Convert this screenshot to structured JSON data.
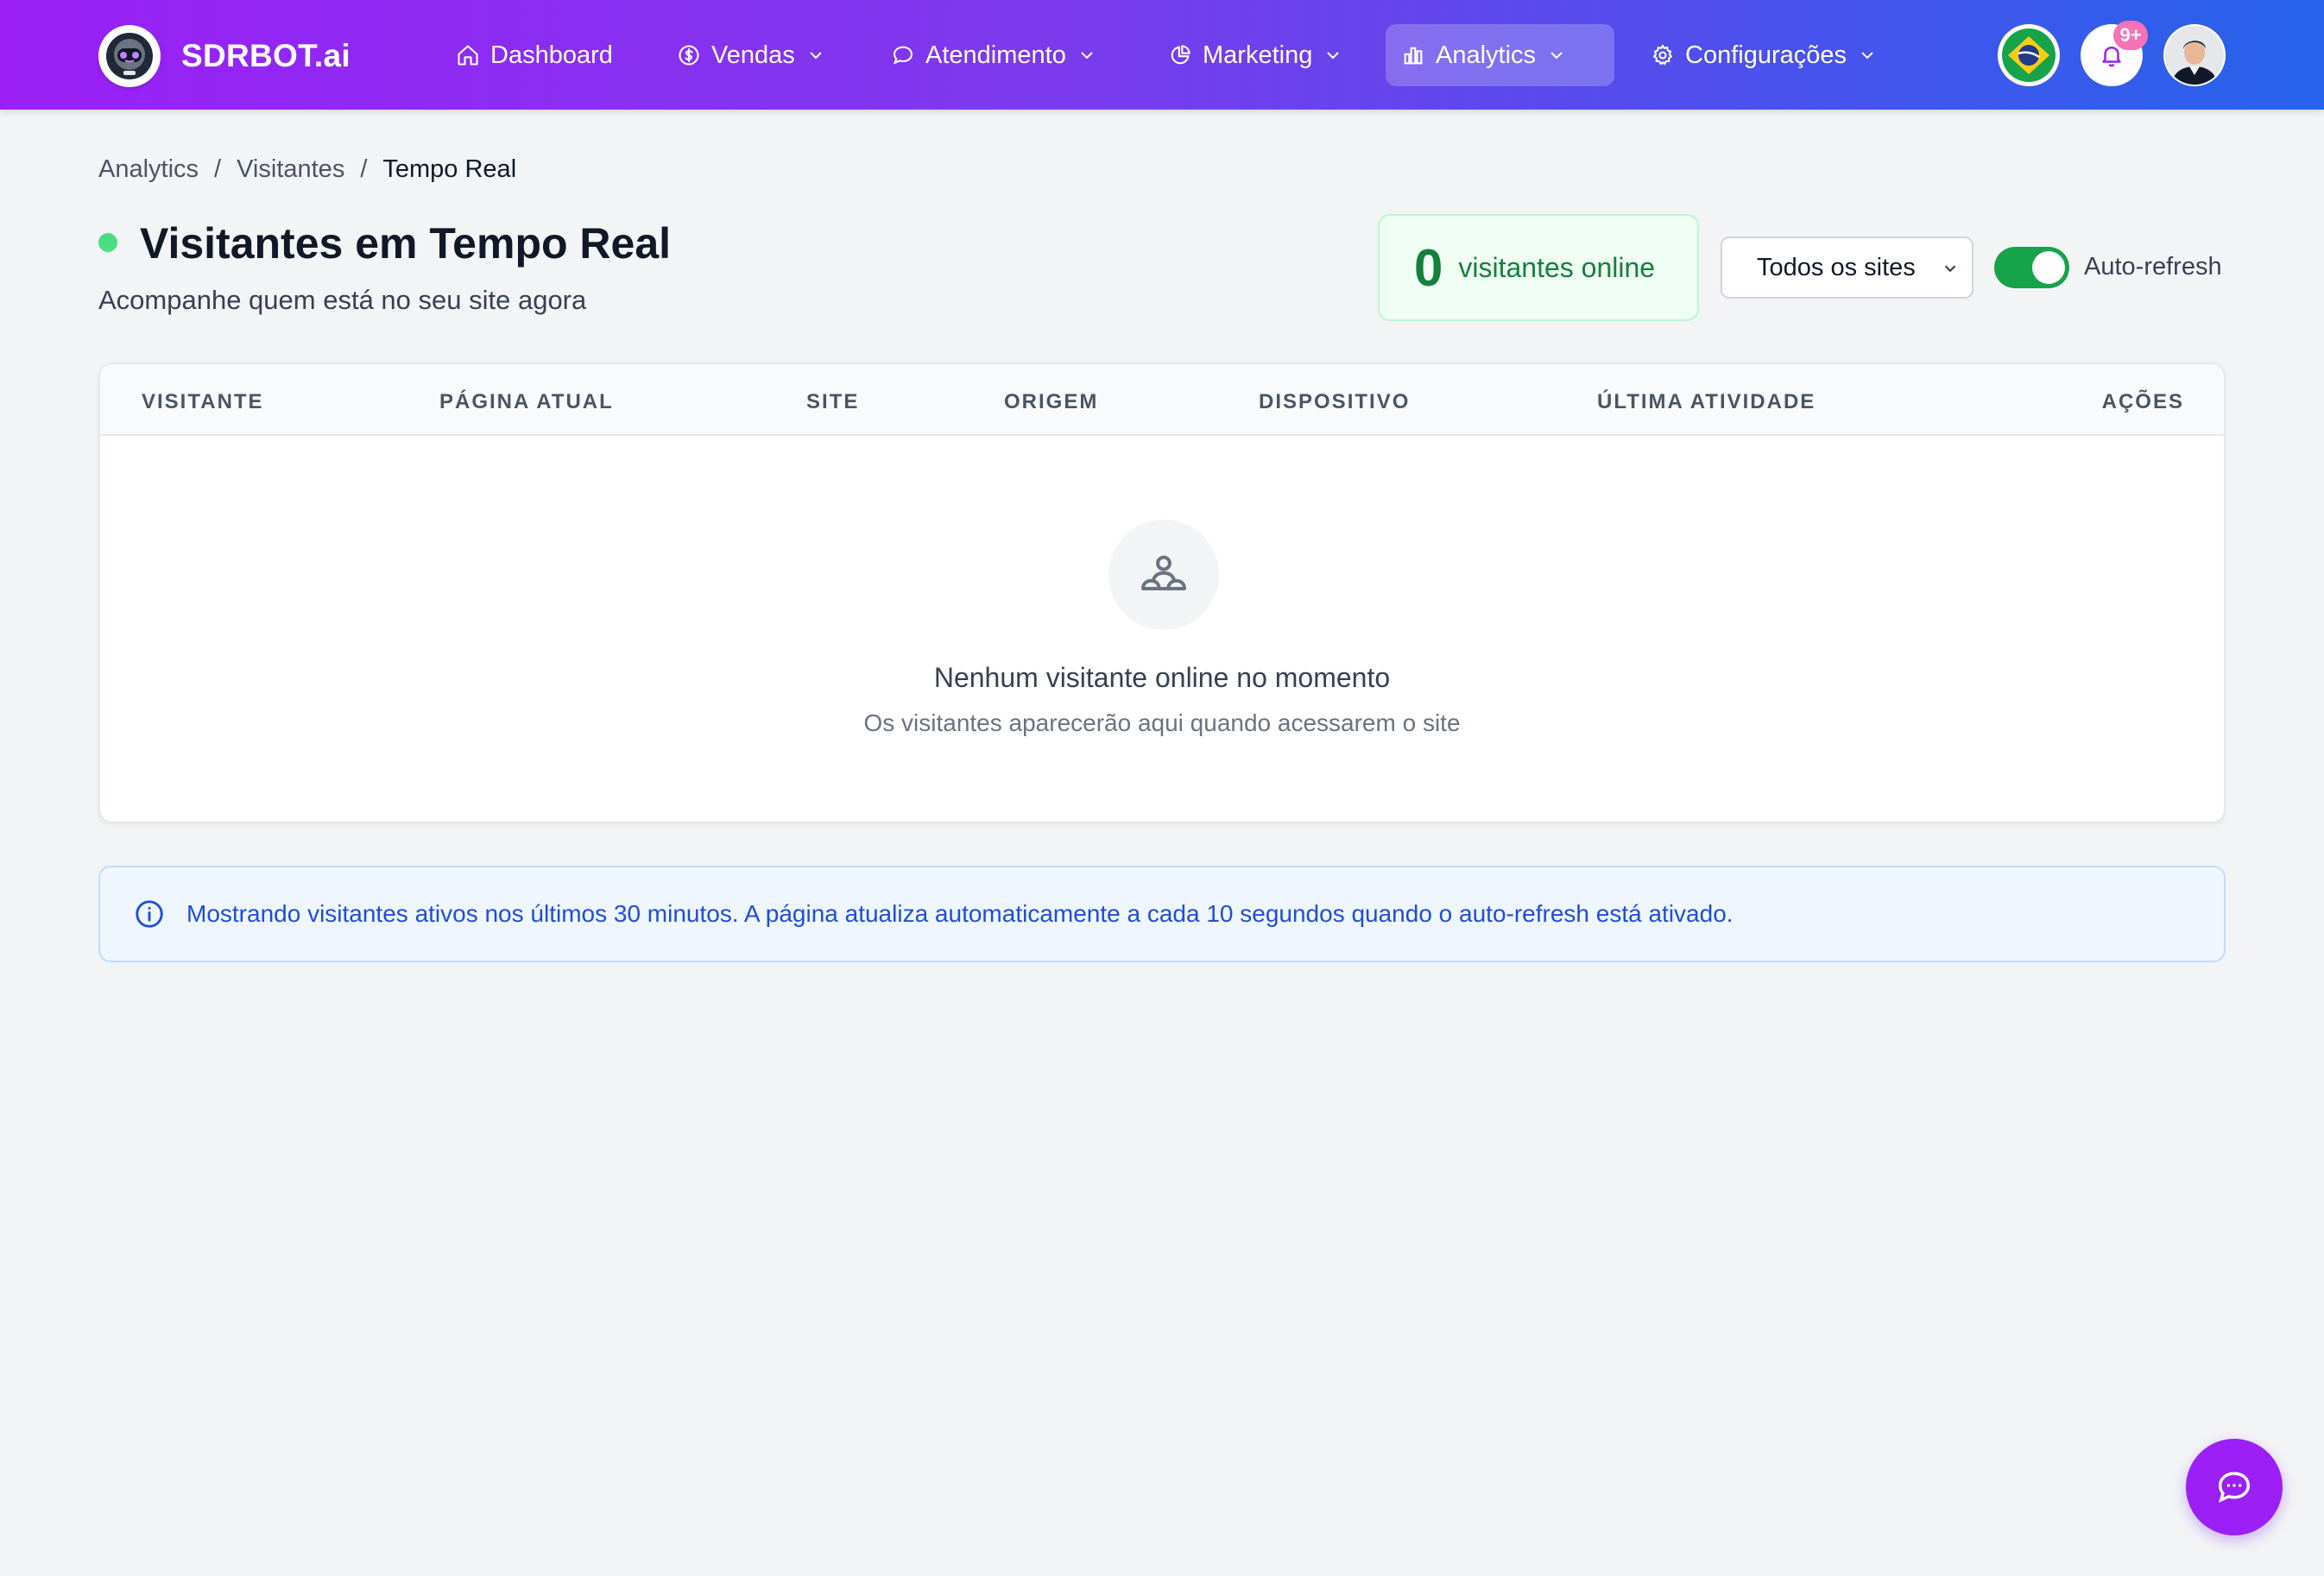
{
  "brand": {
    "name": "SDRBOT.ai",
    "logo_icon": "robot-icon"
  },
  "nav": {
    "items": [
      {
        "label": "Dashboard",
        "icon": "home-icon",
        "has_dropdown": false,
        "active": false
      },
      {
        "label": "Vendas",
        "icon": "dollar-circle-icon",
        "has_dropdown": true,
        "active": false
      },
      {
        "label": "Atendimento",
        "icon": "chat-bubble-icon",
        "has_dropdown": true,
        "active": false
      },
      {
        "label": "Marketing",
        "icon": "pie-chart-icon",
        "has_dropdown": true,
        "active": false
      },
      {
        "label": "Analytics",
        "icon": "bar-chart-icon",
        "has_dropdown": true,
        "active": true
      },
      {
        "label": "Configurações",
        "icon": "gear-icon",
        "has_dropdown": true,
        "active": false
      }
    ],
    "language_flag": "brazil-flag-icon",
    "notifications_badge": "9+"
  },
  "breadcrumb": {
    "items": [
      "Analytics",
      "Visitantes",
      "Tempo Real"
    ],
    "separator": "/"
  },
  "header": {
    "title": "Visitantes em Tempo Real",
    "subtitle": "Acompanhe quem está no seu site agora"
  },
  "online": {
    "count": "0",
    "label": "visitantes online"
  },
  "site_filter": {
    "selected": "Todos os sites"
  },
  "auto_refresh": {
    "label": "Auto-refresh",
    "enabled": true
  },
  "table": {
    "columns": [
      "VISITANTE",
      "PÁGINA ATUAL",
      "SITE",
      "ORIGEM",
      "DISPOSITIVO",
      "ÚLTIMA ATIVIDADE",
      "AÇÕES"
    ],
    "rows": [],
    "empty": {
      "title": "Nenhum visitante online no momento",
      "subtitle": "Os visitantes aparecerão aqui quando acessarem o site"
    }
  },
  "info_banner": {
    "text": "Mostrando visitantes ativos nos últimos 30 minutos. A página atualiza automaticamente a cada 10 segundos quando o auto-refresh está ativado."
  },
  "colors": {
    "nav_gradient_start": "#9b1ff6",
    "nav_gradient_end": "#2563eb",
    "online_green": "#15803d",
    "toggle_on": "#16a34a",
    "info_blue": "#1d4ed8",
    "chat_fab": "#9b1ff6"
  }
}
